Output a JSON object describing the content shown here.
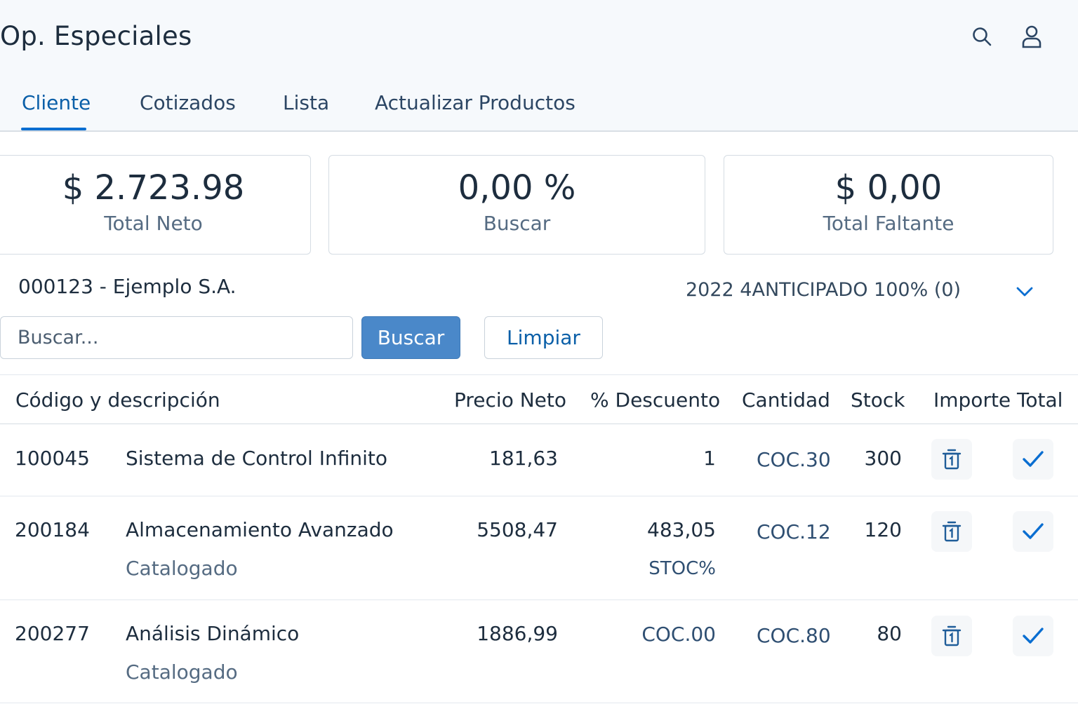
{
  "app": {
    "title": "Op. Especiales"
  },
  "header": {
    "search_icon": "search-icon",
    "user_icon": "user-icon"
  },
  "tabs": [
    {
      "label": "Cliente",
      "active": true
    },
    {
      "label": "Cotizados",
      "active": false
    },
    {
      "label": "Lista",
      "active": false
    },
    {
      "label": "Actualizar Productos",
      "active": false
    }
  ],
  "kpis": [
    {
      "value": "$ 2.723.98",
      "label": "Total Neto"
    },
    {
      "value": "0,00 %",
      "label": "Buscar"
    },
    {
      "value": "$ 0,00",
      "label": "Total Faltante"
    }
  ],
  "customer": {
    "name": "000123 - Ejemplo S.A.",
    "terms": "2022 4ANTICIPADO 100% (0)"
  },
  "search": {
    "placeholder": "Buscar...",
    "value": "",
    "search_label": "Buscar",
    "clear_label": "Limpiar"
  },
  "table": {
    "columns": [
      "Código y descripción",
      "Precio Neto",
      "% Descuento",
      "Cantidad",
      "Stock",
      "Importe Total"
    ],
    "rows": [
      {
        "code": "100045",
        "description": "Sistema de Control Infinito",
        "subtitle": "",
        "price": "181,63",
        "discount": "1",
        "discount_sub": "",
        "quantity": "COC.30",
        "stock": "300"
      },
      {
        "code": "200184",
        "description": "Almacenamiento Avanzado",
        "subtitle": "Catalogado",
        "price": "5508,47",
        "discount": "483,05",
        "discount_sub": "STOC%",
        "quantity": "COC.12",
        "stock": "120"
      },
      {
        "code": "200277",
        "description": "Análisis Dinámico",
        "subtitle": "Catalogado",
        "price": "1886,99",
        "discount": "COC.00",
        "discount_sub": "",
        "quantity": "COC.80",
        "stock": "80"
      }
    ]
  },
  "colors": {
    "accent": "#0a6ed1",
    "primary_button": "#4a88c9",
    "text": "#1d2d3e",
    "muted": "#556b82"
  }
}
